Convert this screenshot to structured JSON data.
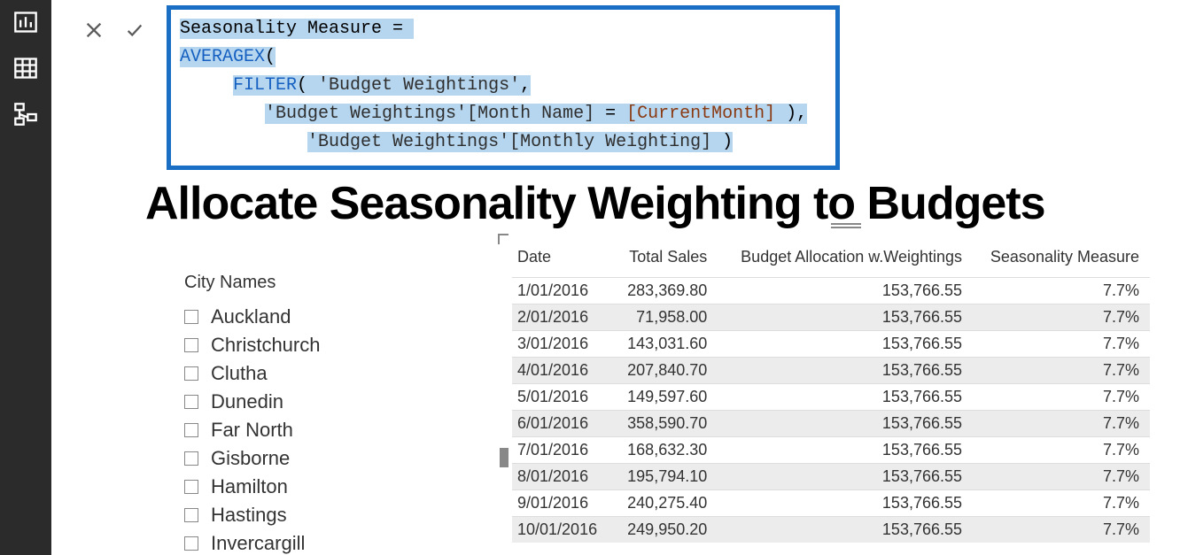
{
  "nav": {
    "report_icon": "report-icon",
    "data_icon": "data-icon",
    "model_icon": "model-icon"
  },
  "formula": {
    "line1_a": "Seasonality Measure = ",
    "line2_fn": "AVERAGEX",
    "line2_b": "(",
    "line3_pad": "     ",
    "line3_fn": "FILTER",
    "line3_b": "( ",
    "line3_tbl": "'Budget Weightings'",
    "line3_c": ",",
    "line4_pad": "        ",
    "line4_tbl": "'Budget Weightings'",
    "line4_col": "[Month Name]",
    "line4_eq": " = ",
    "line4_meas": "[CurrentMonth]",
    "line4_c": " ),",
    "line5_pad": "            ",
    "line5_tbl": "'Budget Weightings'",
    "line5_col": "[Monthly Weighting]",
    "line5_c": " )"
  },
  "title": "Allocate Seasonality Weighting to Budgets",
  "slicer": {
    "header": "City Names",
    "items": [
      {
        "label": "Auckland"
      },
      {
        "label": "Christchurch"
      },
      {
        "label": "Clutha"
      },
      {
        "label": "Dunedin"
      },
      {
        "label": "Far North"
      },
      {
        "label": "Gisborne"
      },
      {
        "label": "Hamilton"
      },
      {
        "label": "Hastings"
      },
      {
        "label": "Invercargill"
      }
    ]
  },
  "table": {
    "headers": {
      "c0": "Date",
      "c1": "Total Sales",
      "c2": "Budget Allocation w.Weightings",
      "c3": "Seasonality Measure"
    },
    "rows": [
      {
        "c0": "1/01/2016",
        "c1": "283,369.80",
        "c2": "153,766.55",
        "c3": "7.7%"
      },
      {
        "c0": "2/01/2016",
        "c1": "71,958.00",
        "c2": "153,766.55",
        "c3": "7.7%"
      },
      {
        "c0": "3/01/2016",
        "c1": "143,031.60",
        "c2": "153,766.55",
        "c3": "7.7%"
      },
      {
        "c0": "4/01/2016",
        "c1": "207,840.70",
        "c2": "153,766.55",
        "c3": "7.7%"
      },
      {
        "c0": "5/01/2016",
        "c1": "149,597.60",
        "c2": "153,766.55",
        "c3": "7.7%"
      },
      {
        "c0": "6/01/2016",
        "c1": "358,590.70",
        "c2": "153,766.55",
        "c3": "7.7%"
      },
      {
        "c0": "7/01/2016",
        "c1": "168,632.30",
        "c2": "153,766.55",
        "c3": "7.7%"
      },
      {
        "c0": "8/01/2016",
        "c1": "195,794.10",
        "c2": "153,766.55",
        "c3": "7.7%"
      },
      {
        "c0": "9/01/2016",
        "c1": "240,275.40",
        "c2": "153,766.55",
        "c3": "7.7%"
      },
      {
        "c0": "10/01/2016",
        "c1": "249,950.20",
        "c2": "153,766.55",
        "c3": "7.7%"
      }
    ]
  }
}
